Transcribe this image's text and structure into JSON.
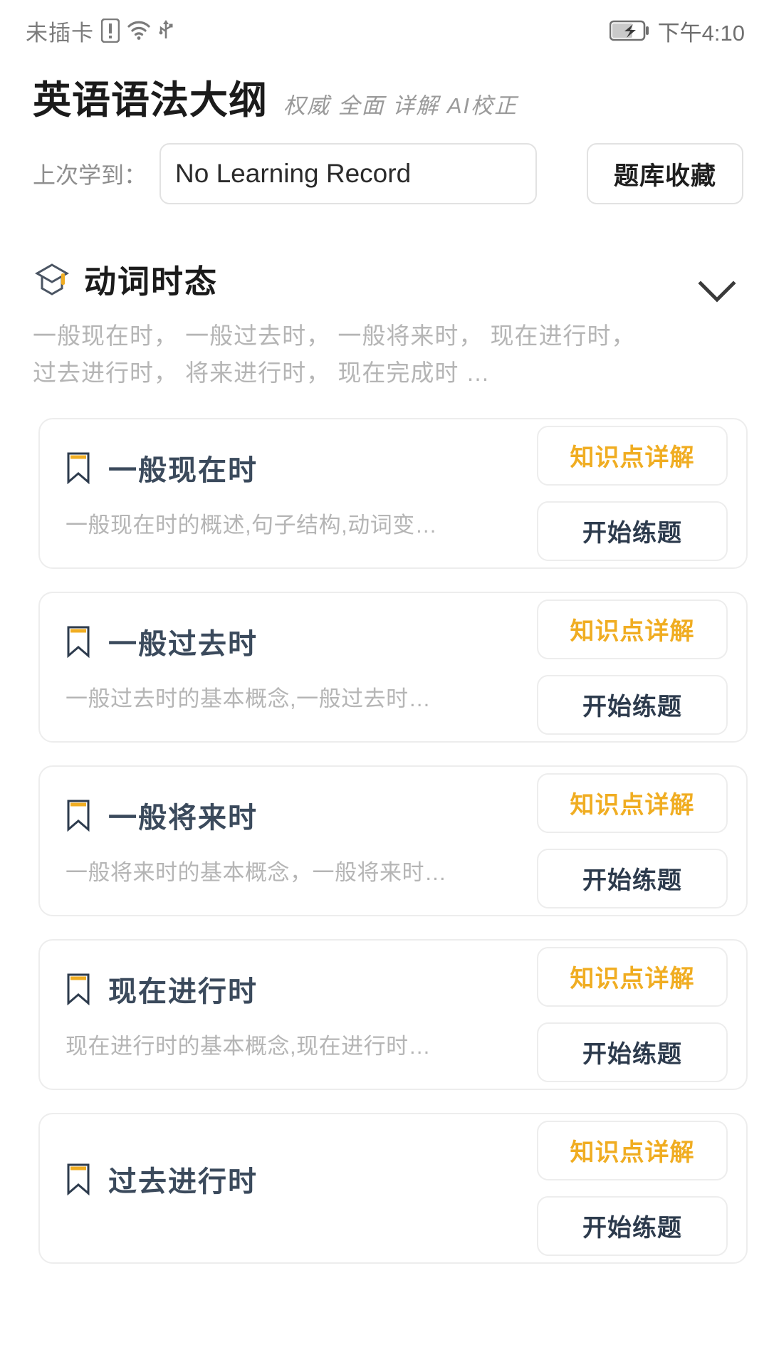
{
  "status_bar": {
    "carrier": "未插卡",
    "time": "下午4:10",
    "icons": [
      "sim-warning-icon",
      "wifi-icon",
      "usb-icon",
      "battery-charging-icon"
    ]
  },
  "header": {
    "title": "英语语法大纲",
    "subtitle": "权威 全面 详解 AI校正"
  },
  "learning_record": {
    "label": "上次学到：",
    "value": "No Learning Record",
    "favorites_button": "题库收藏"
  },
  "section": {
    "icon": "graduation-cap-icon",
    "title": "动词时态",
    "description": "一般现在时， 一般过去时， 一般将来时， 现在进行时， 过去进行时， 将来进行时， 现在完成时 …",
    "collapse_icon": "chevron-down-icon"
  },
  "actions": {
    "detail_label": "知识点详解",
    "practice_label": "开始练题"
  },
  "colors": {
    "accent_orange": "#f0ad22",
    "title_navy": "#3b4a5c",
    "muted_gray": "#b5b5b5",
    "border_gray": "#ededed"
  },
  "cards": [
    {
      "title": "一般现在时",
      "description": "一般现在时的概述,句子结构,动词变…",
      "bookmark_icon": "bookmark-icon"
    },
    {
      "title": "一般过去时",
      "description": "一般过去时的基本概念,一般过去时…",
      "bookmark_icon": "bookmark-icon"
    },
    {
      "title": "一般将来时",
      "description": "一般将来时的基本概念，一般将来时…",
      "bookmark_icon": "bookmark-icon"
    },
    {
      "title": "现在进行时",
      "description": "现在进行时的基本概念,现在进行时…",
      "bookmark_icon": "bookmark-icon"
    },
    {
      "title": "过去进行时",
      "description": "",
      "bookmark_icon": "bookmark-icon"
    }
  ]
}
